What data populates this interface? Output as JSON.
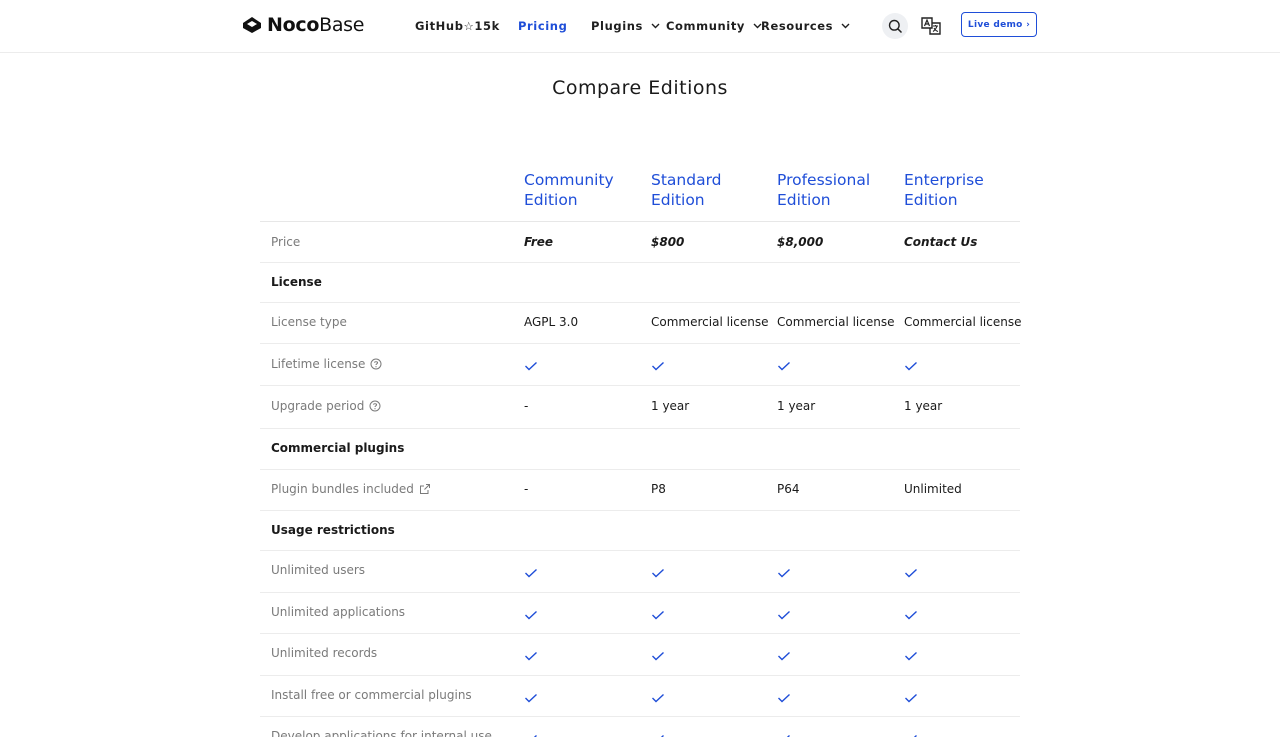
{
  "header": {
    "logo_noco": "Noco",
    "logo_base": "Base",
    "nav": [
      {
        "label": "GitHub☆15k"
      },
      {
        "label": "Pricing"
      },
      {
        "label": "Plugins"
      },
      {
        "label": "Community"
      },
      {
        "label": "Resources"
      }
    ],
    "live_demo": "Live demo ›",
    "icons": {
      "search": "search-icon",
      "translate": "translate-icon",
      "chevron": "chevron-down-icon"
    }
  },
  "page_title": "Compare Editions",
  "editions": [
    {
      "line1": "Community",
      "line2": "Edition"
    },
    {
      "line1": "Standard",
      "line2": "Edition"
    },
    {
      "line1": "Professional",
      "line2": "Edition"
    },
    {
      "line1": "Enterprise",
      "line2": "Edition"
    }
  ],
  "rows": {
    "price": {
      "label": "Price",
      "values": [
        "Free",
        "$800",
        "$8,000",
        "Contact Us"
      ]
    },
    "license_section": {
      "label": "License"
    },
    "license_type": {
      "label": "License type",
      "values": [
        "AGPL 3.0",
        "Commercial license",
        "Commercial license",
        "Commercial license"
      ]
    },
    "lifetime_license": {
      "label": "Lifetime license",
      "values": [
        "check",
        "check",
        "check",
        "check"
      ]
    },
    "upgrade_period": {
      "label": "Upgrade period",
      "values": [
        "-",
        "1 year",
        "1 year",
        "1 year"
      ]
    },
    "commercial_plugins_section": {
      "label": "Commercial plugins"
    },
    "plugin_bundles": {
      "label": "Plugin bundles included",
      "values": [
        "-",
        "P8",
        "P64",
        "Unlimited"
      ]
    },
    "usage_section": {
      "label": "Usage restrictions"
    },
    "unlimited_users": {
      "label": "Unlimited users",
      "values": [
        "check",
        "check",
        "check",
        "check"
      ]
    },
    "unlimited_applications": {
      "label": "Unlimited applications",
      "values": [
        "check",
        "check",
        "check",
        "check"
      ]
    },
    "unlimited_records": {
      "label": "Unlimited records",
      "values": [
        "check",
        "check",
        "check",
        "check"
      ]
    },
    "install_plugins": {
      "label": "Install free or commercial plugins",
      "values": [
        "check",
        "check",
        "check",
        "check"
      ]
    },
    "develop_internal": {
      "label": "Develop applications for internal use",
      "values": [
        "check",
        "check",
        "check",
        "check"
      ]
    }
  },
  "colors": {
    "accent": "#1f4ed8",
    "muted_text": "#7a7a7a",
    "divider": "#ececec"
  }
}
